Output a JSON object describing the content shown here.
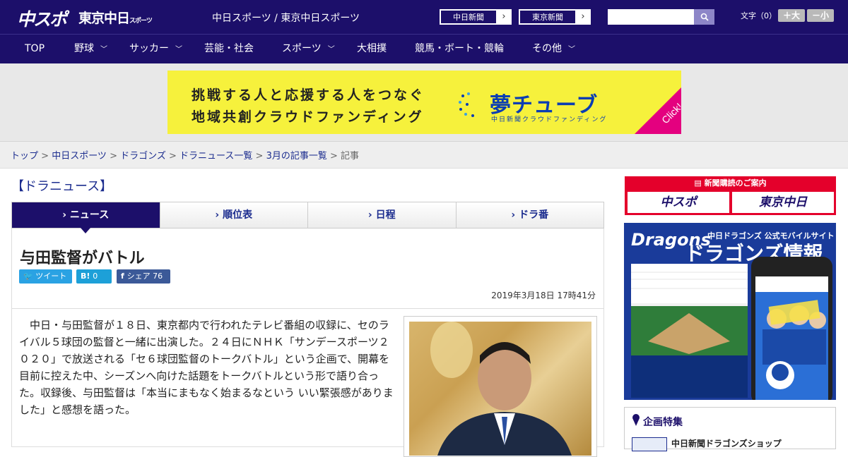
{
  "header": {
    "logo_chuspo": "中スポ",
    "logo_tokyo": "東京中日",
    "logo_tokyo_small": "スポーツ",
    "tagline": "中日スポーツ / 東京中日スポーツ",
    "btn_chunichi": "中日新聞",
    "btn_tokyo": "東京新聞",
    "search_placeholder": "",
    "font_label": "文字（0）",
    "font_bigger": "＋大",
    "font_smaller": "－小"
  },
  "nav": [
    {
      "label": "TOP",
      "dropdown": false
    },
    {
      "label": "野球",
      "dropdown": true
    },
    {
      "label": "サッカー",
      "dropdown": true
    },
    {
      "label": "芸能・社会",
      "dropdown": false
    },
    {
      "label": "スポーツ",
      "dropdown": true
    },
    {
      "label": "大相撲",
      "dropdown": false
    },
    {
      "label": "競馬・ボート・競輪",
      "dropdown": false
    },
    {
      "label": "その他",
      "dropdown": true
    }
  ],
  "banner": {
    "line1": "挑戦する人と応援する人をつなぐ",
    "line2": "地域共創クラウドファンディング",
    "logo": "夢チューブ",
    "sub": "中日新聞クラウドファンディング",
    "click": "Click!"
  },
  "breadcrumb": {
    "items": [
      "トップ",
      "中日スポーツ",
      "ドラゴンズ",
      "ドラニュース一覧",
      "3月の記事一覧"
    ],
    "current": "記事"
  },
  "section_title": "【ドラニュース】",
  "tabs": [
    {
      "label": "ニュース",
      "active": true
    },
    {
      "label": "順位表",
      "active": false
    },
    {
      "label": "日程",
      "active": false
    },
    {
      "label": "ドラ番",
      "active": false
    }
  ],
  "article": {
    "title": "与田監督がバトル",
    "tweet_label": "ツイート",
    "hatena_label": "B!",
    "hatena_count": "0",
    "fb_label": "シェア",
    "fb_count": "76",
    "date": "2019年3月18日 17時41分",
    "body": "中日・与田監督が１８日、東京都内で行われたテレビ番組の収録に、セのライバル５球団の監督と一緒に出演した。２４日にＮＨＫ「サンデースポーツ２０２０」で放送される「セ６球団監督のトークバトル」という企画で、開幕を目前に控えた中、シーズンへ向けた話題をトークバトルという形で語り合った。収録後、与田監督は「本当にまもなく始まるなという いい緊張感がありました」と感想を語った。"
  },
  "sidebar": {
    "subscribe_title": "新聞購読のご案内",
    "subscribe_chuspo": "中スポ",
    "subscribe_tokyo": "東京中日",
    "dragons_logo": "Dragons",
    "dragons_sub": "中日ドラゴンズ 公式モバイルサイト",
    "dragons_main": "ドラゴンズ情報",
    "feature_title": "企画特集",
    "feature_item": "中日新聞ドラゴンズショップ"
  },
  "colors": {
    "header_bg": "#1c0f6a",
    "banner_bg": "#f6f13c",
    "subscribe_red": "#e4002b",
    "twitter": "#2aa2e3",
    "hatena": "#1da0d8",
    "facebook": "#3b5998"
  }
}
